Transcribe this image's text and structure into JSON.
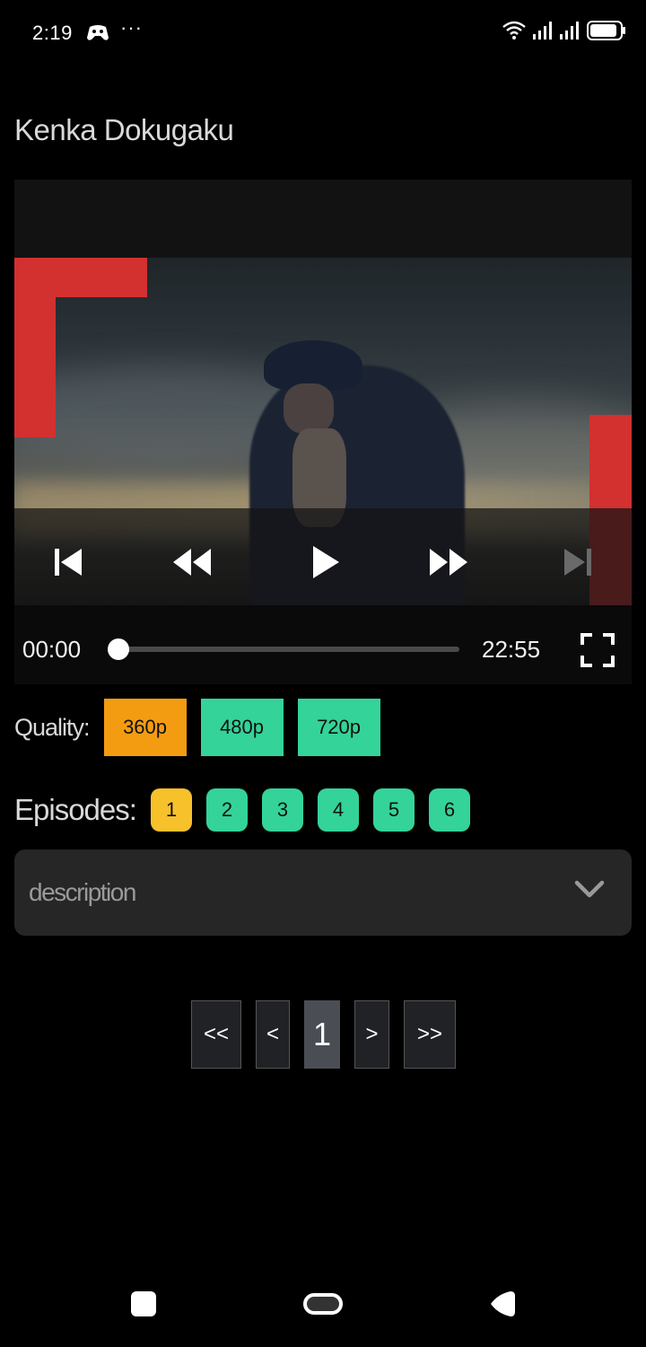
{
  "status_bar": {
    "time": "2:19",
    "dots": "···",
    "battery_level": 0.9
  },
  "page": {
    "title": "Kenka Dokugaku"
  },
  "player": {
    "current_time": "00:00",
    "total_time": "22:55",
    "progress": 0.0,
    "controls": [
      "skip-previous",
      "rewind",
      "play",
      "fast-forward",
      "skip-next"
    ]
  },
  "quality": {
    "label": "Quality:",
    "options": [
      {
        "label": "360p",
        "selected": true
      },
      {
        "label": "480p",
        "selected": false
      },
      {
        "label": "720p",
        "selected": false
      }
    ]
  },
  "episodes": {
    "label": "Episodes:",
    "items": [
      {
        "label": "1",
        "selected": true
      },
      {
        "label": "2",
        "selected": false
      },
      {
        "label": "3",
        "selected": false
      },
      {
        "label": "4",
        "selected": false
      },
      {
        "label": "5",
        "selected": false
      },
      {
        "label": "6",
        "selected": false
      }
    ]
  },
  "description": {
    "label": "description",
    "expanded": false
  },
  "pagination": {
    "first": "<<",
    "prev": "<",
    "current": "1",
    "next": ">",
    "last": ">>"
  },
  "colors": {
    "selected": "#f39c12",
    "episode_selected": "#f6c12b",
    "unselected": "#34d399",
    "frame_red": "#d33030"
  }
}
